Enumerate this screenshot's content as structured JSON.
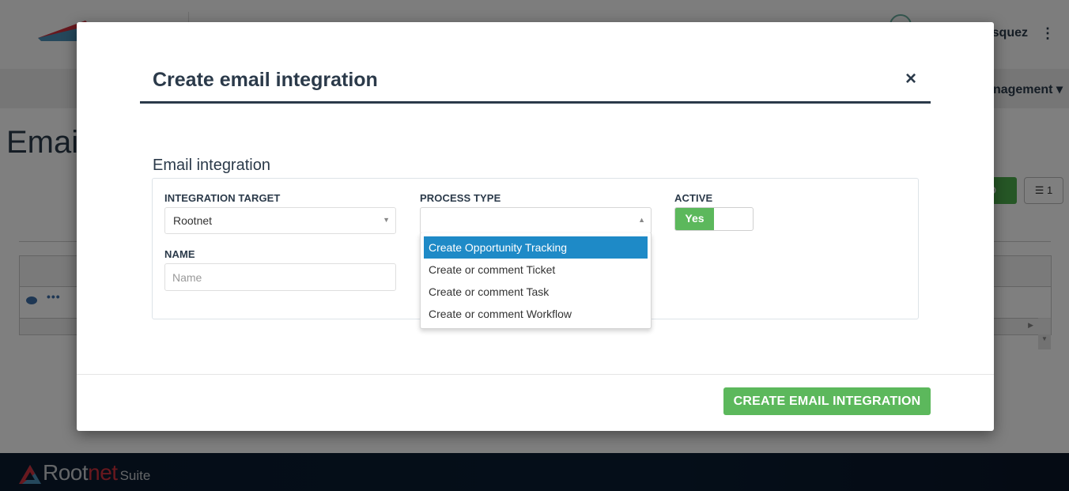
{
  "background": {
    "user_name": "squez",
    "nav_item": "nagement",
    "page_title": "Email",
    "add_button": "ADD",
    "columns_button_count": "1",
    "footer": {
      "brand_part1": "Root",
      "brand_part2": "net",
      "brand_suffix": "Suite"
    }
  },
  "modal": {
    "title": "Create email integration",
    "close_icon": "×",
    "section_title": "Email integration",
    "fields": {
      "integration_target": {
        "label": "INTEGRATION TARGET",
        "value": "Rootnet"
      },
      "process_type": {
        "label": "PROCESS TYPE",
        "value": "",
        "options": [
          "Create Opportunity Tracking",
          "Create or comment Ticket",
          "Create or comment Task",
          "Create or comment Workflow"
        ],
        "highlighted_option": "Create Opportunity Tracking"
      },
      "active": {
        "label": "ACTIVE",
        "value": "Yes",
        "on": true
      },
      "name": {
        "label": "NAME",
        "value": "",
        "placeholder": "Name"
      }
    },
    "submit_label": "CREATE EMAIL INTEGRATION"
  },
  "colors": {
    "primary_text": "#2b3a4a",
    "success": "#5cb85c",
    "highlight": "#1e8ac7",
    "brand_red": "#d0313d"
  }
}
